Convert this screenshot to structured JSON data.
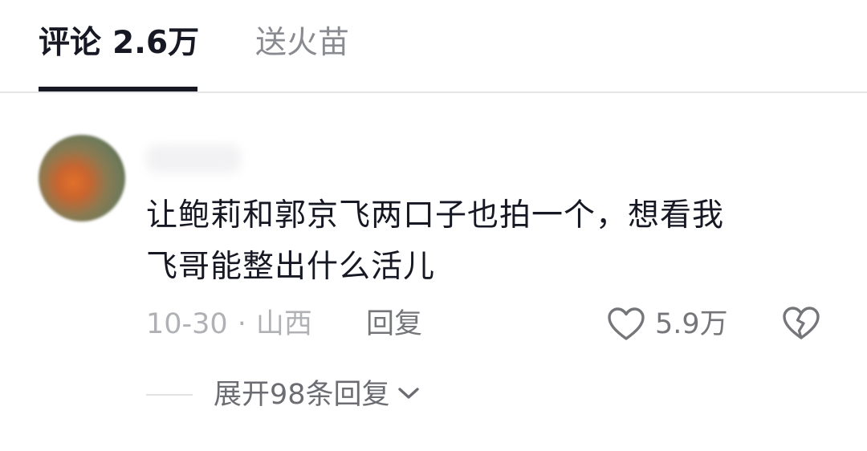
{
  "tabs": {
    "comments_label": "评论",
    "comments_count": "2.6万",
    "sparks_label": "送火苗"
  },
  "comment": {
    "username": "",
    "text_line1": "让鲍莉和郭京飞两口子也拍一个，想看我",
    "text_line2": "飞哥能整出什么活儿",
    "date": "10-30",
    "separator": "·",
    "location": "山西",
    "reply_label": "回复",
    "like_count": "5.9万",
    "expand_label": "展开98条回复"
  },
  "icons": {
    "like": "heart-outline-icon",
    "dislike": "broken-heart-icon",
    "expand": "chevron-down-icon"
  },
  "colors": {
    "text_primary": "#161823",
    "text_secondary": "#75767a",
    "text_tertiary": "#b0b1b5",
    "tab_inactive": "#8a8b91",
    "divider": "#e5e5e7"
  }
}
